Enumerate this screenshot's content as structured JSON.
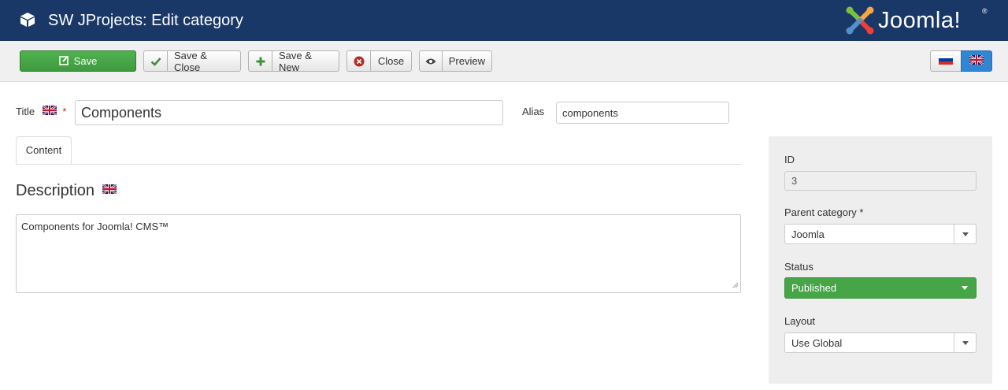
{
  "header": {
    "title": "SW JProjects: Edit category",
    "logo_text": "Joomla!",
    "logo_reg": "®"
  },
  "toolbar": {
    "save_label": "Save",
    "save_close_label": "Save & Close",
    "save_new_label": "Save & New",
    "close_label": "Close",
    "preview_label": "Preview"
  },
  "form": {
    "title_label": "Title",
    "required_mark": "*",
    "title_value": "Components",
    "alias_label": "Alias",
    "alias_value": "components"
  },
  "tabs": [
    {
      "label": "Content",
      "active": true
    }
  ],
  "content": {
    "description_heading": "Description",
    "description_text": "Components for Joomla! CMS™"
  },
  "sidebar": {
    "id_label": "ID",
    "id_value": "3",
    "parent_label": "Parent category *",
    "parent_value": "Joomla",
    "status_label": "Status",
    "status_value": "Published",
    "layout_label": "Layout",
    "layout_value": "Use Global"
  },
  "colors": {
    "header_bg": "#1a3867",
    "save_green": "#46a546",
    "status_green": "#46a546",
    "active_lang_blue": "#2f86d4"
  },
  "languages": [
    {
      "code": "ru",
      "icon": "russian-flag-icon",
      "active": false
    },
    {
      "code": "en",
      "icon": "uk-flag-icon",
      "active": true
    }
  ]
}
